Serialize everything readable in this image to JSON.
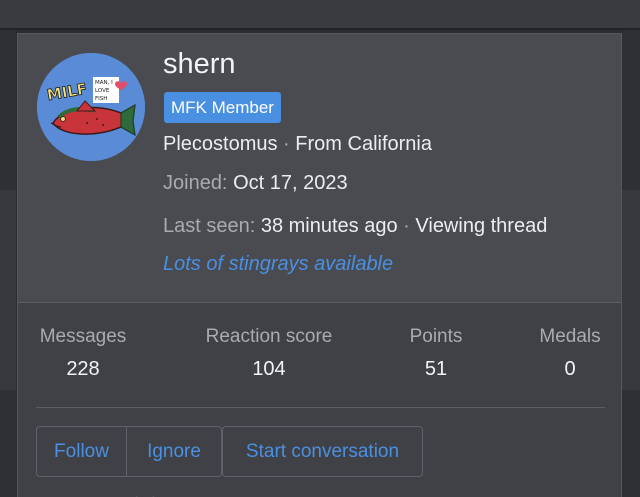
{
  "profile": {
    "username": "shern",
    "badge": "MFK Member",
    "species": "Plecostomus",
    "separator": " · ",
    "location": "From California",
    "joined_label": "Joined: ",
    "joined_value": "Oct 17, 2023",
    "last_seen_label": "Last seen: ",
    "last_seen_value": "38 minutes ago",
    "activity": "Viewing thread",
    "status_message": "Lots of stingrays available",
    "avatar": {
      "icon": "fish-avatar-icon",
      "text_main": "MILF",
      "text_line1": "MAN, I",
      "text_line2": "LOVE",
      "text_line3": "FISH",
      "bg_color": "#5a8bd6",
      "fish_color": "#c9343a"
    }
  },
  "stats": {
    "messages": {
      "label": "Messages",
      "value": "228"
    },
    "reaction_score": {
      "label": "Reaction score",
      "value": "104"
    },
    "points": {
      "label": "Points",
      "value": "51"
    },
    "medals": {
      "label": "Medals",
      "value": "0"
    }
  },
  "actions": {
    "follow": "Follow",
    "ignore": "Ignore",
    "start_conversation": "Start conversation"
  },
  "colors": {
    "accent": "#4a90e2",
    "card_bg": "#45474c",
    "page_bg": "#2b2c30"
  }
}
